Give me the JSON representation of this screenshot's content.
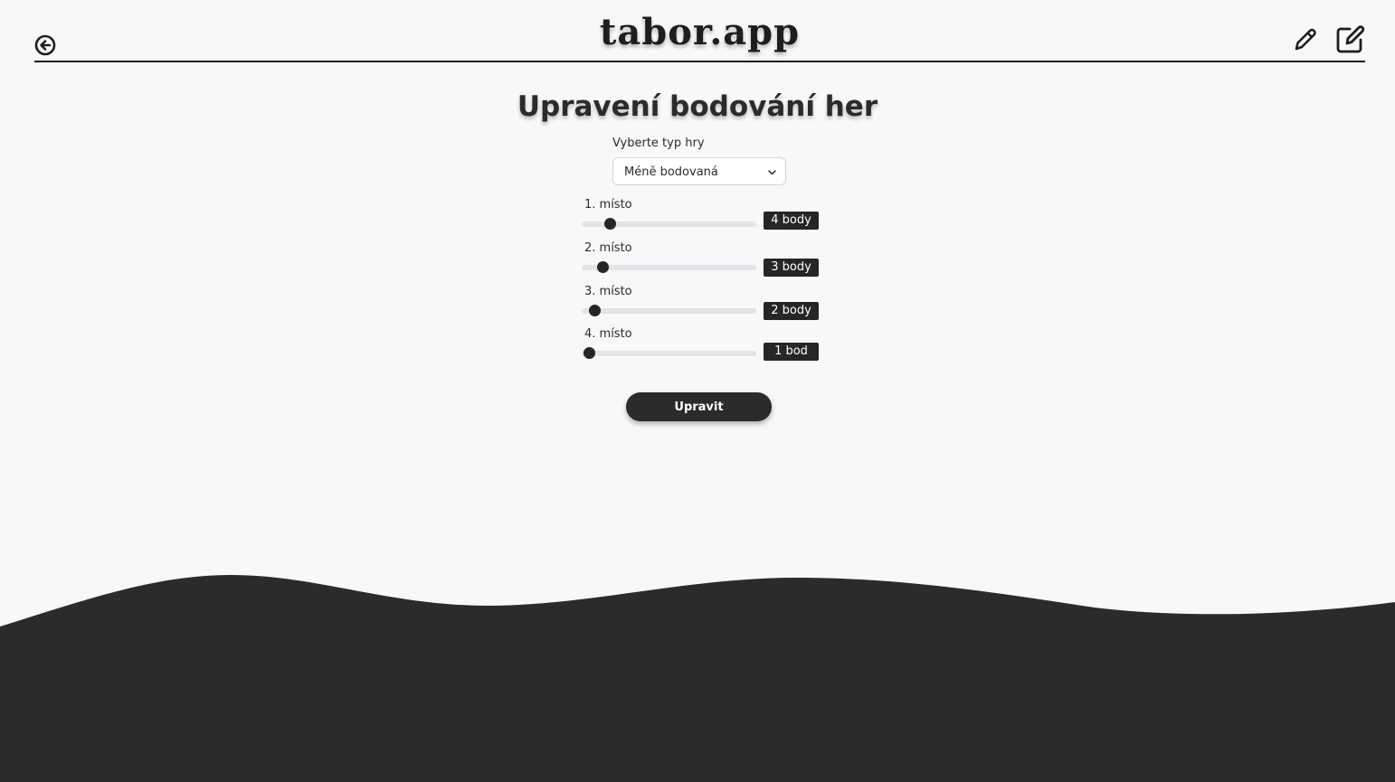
{
  "header": {
    "brand": "tabor.app",
    "icons": [
      "back-arrow-circle-icon",
      "pencil-icon",
      "edit-square-icon"
    ]
  },
  "form": {
    "title": "Upravení bodování her",
    "select_label": "Vyberte typ hry",
    "select_value": "Méně bodovaná",
    "places": [
      {
        "label": "1. místo",
        "points_label": "4 body",
        "level": 0.16
      },
      {
        "label": "2. místo",
        "points_label": "3 body",
        "level": 0.12
      },
      {
        "label": "3. místo",
        "points_label": "2 body",
        "level": 0.075
      },
      {
        "label": "4. místo",
        "points_label": "1 bod",
        "level": 0.04
      }
    ],
    "submit_label": "Upravit"
  },
  "colors": {
    "background": "#f7f8fa",
    "dark": "#2b2b2b",
    "track": "#e4e4e7"
  }
}
